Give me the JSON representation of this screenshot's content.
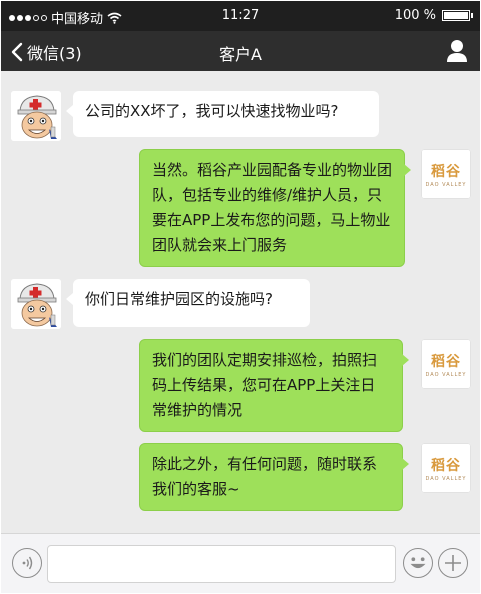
{
  "status_bar": {
    "carrier": "中国移动",
    "time": "11:27",
    "battery": "100 %",
    "battery_level": 1.0,
    "signal_bars_filled": 3,
    "signal_bars_total": 5
  },
  "nav": {
    "back_label": "微信(3)",
    "title": "客户A"
  },
  "messages": [
    {
      "direction": "incoming",
      "sender": "customer",
      "avatar": "nurse-cartoon-avatar",
      "text": "公司的XX坏了，我可以快速找物业吗?"
    },
    {
      "direction": "outgoing",
      "sender": "company",
      "avatar": "daogu-logo",
      "text": "当然。稻谷产业园配备专业的物业团队，包括专业的维修/维护人员，只要在APP上发布您的问题，马上物业团队就会来上门服务"
    },
    {
      "direction": "incoming",
      "sender": "customer",
      "avatar": "nurse-cartoon-avatar",
      "text": "你们日常维护园区的设施吗?"
    },
    {
      "direction": "outgoing",
      "sender": "company",
      "avatar": "daogu-logo",
      "text": "我们的团队定期安排巡检，拍照扫码上传结果，您可在APP上关注日常维护的情况"
    },
    {
      "direction": "outgoing",
      "sender": "company",
      "avatar": "daogu-logo",
      "text": "除此之外，有任何问题，随时联系我们的客服~"
    }
  ],
  "company_logo": {
    "text_cn": "稻谷",
    "text_en": "DAO VALLEY",
    "color": "#d99a3e"
  },
  "input_bar": {
    "value": "",
    "placeholder": ""
  },
  "colors": {
    "status_bar_bg": "#1f1f1f",
    "nav_bg": "#2e2e2e",
    "chat_bg": "#ebebeb",
    "outgoing_bubble": "#9ee05a",
    "incoming_bubble": "#ffffff"
  }
}
